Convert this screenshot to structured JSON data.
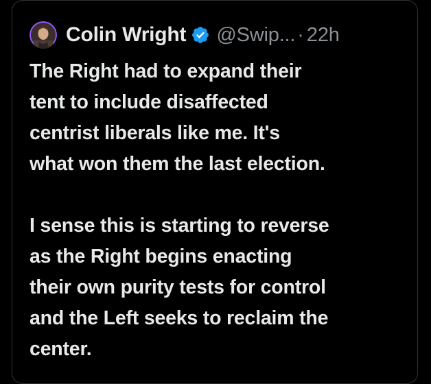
{
  "tweet": {
    "author_name": "Colin Wright",
    "handle": "@Swip...",
    "separator": "·",
    "time": "22h",
    "paragraphs": [
      [
        "The Right had to expand their",
        "tent to include disaffected",
        "centrist liberals like me. It's",
        "what won them the last election."
      ],
      [
        "I sense this is starting to reverse",
        "as the Right begins enacting",
        "their own purity tests for control",
        "and the Left seeks to reclaim the",
        "center."
      ]
    ]
  },
  "icons": {
    "avatar": "avatar-image",
    "verified": "verified-badge-icon"
  },
  "colors": {
    "background": "#000000",
    "text_primary": "#e7e9ea",
    "text_secondary": "#8b9096",
    "verified_blue": "#1d9bf0",
    "avatar_ring": "#9b59ff",
    "card_border": "#2f3336"
  }
}
